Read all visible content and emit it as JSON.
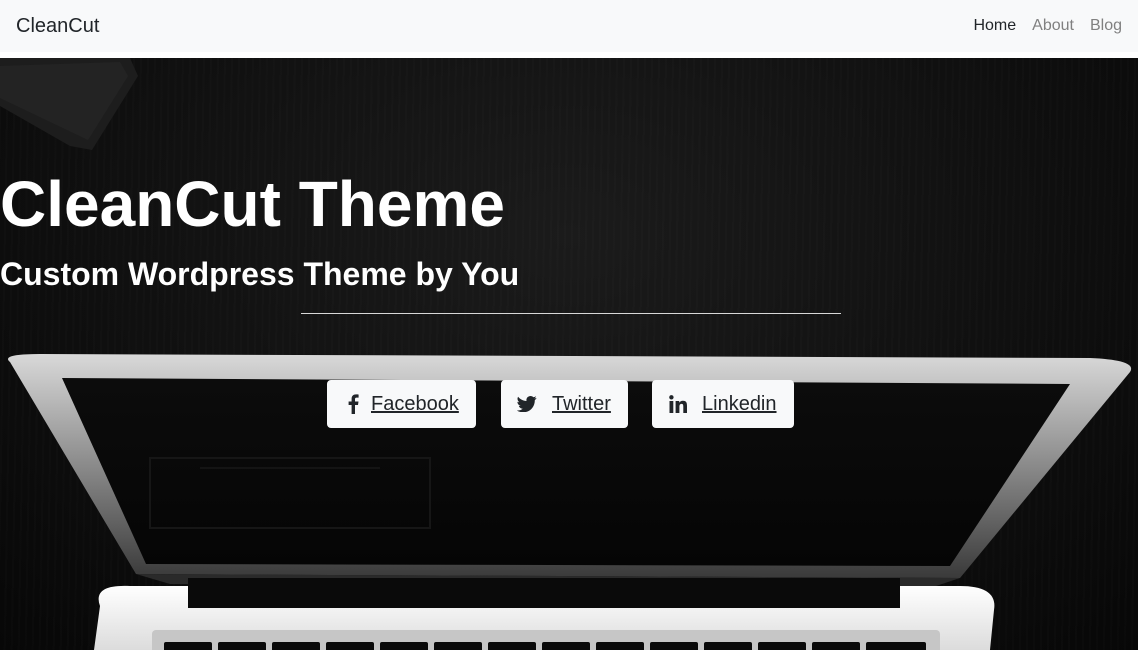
{
  "navbar": {
    "brand": "CleanCut",
    "links": [
      {
        "label": "Home",
        "active": true
      },
      {
        "label": "About",
        "active": false
      },
      {
        "label": "Blog",
        "active": false
      }
    ]
  },
  "hero": {
    "title": "CleanCut Theme",
    "subtitle": "Custom Wordpress Theme by You",
    "buttons": [
      {
        "label": "Facebook",
        "icon": "facebook-icon"
      },
      {
        "label": "Twitter",
        "icon": "twitter-icon"
      },
      {
        "label": "Linkedin",
        "icon": "linkedin-icon"
      }
    ]
  },
  "colors": {
    "navbar_bg": "#f8f9fa",
    "text_dark": "#212529",
    "nav_muted": "#808080",
    "hero_text": "#ffffff"
  }
}
